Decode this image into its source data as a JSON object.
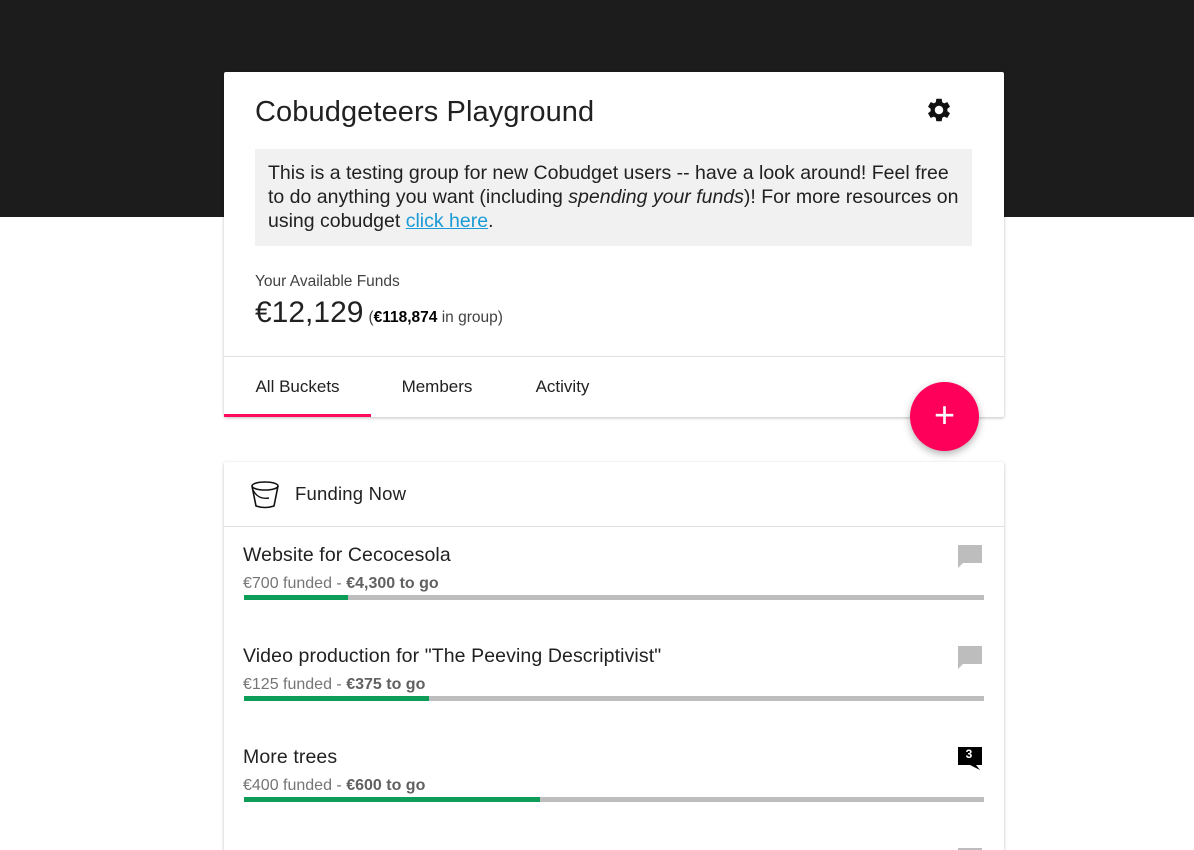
{
  "group": {
    "title": "Cobudgeteers Playground",
    "description": {
      "part1": "This is a testing group for new Cobudget users -- have a look around! Feel free to do anything you want (including ",
      "emphasis": "spending your funds",
      "part2": ")! For more resources on using cobudget ",
      "link_text": "click here",
      "part3": "."
    },
    "funds_label": "Your Available Funds",
    "funds_amount": "€12,129",
    "funds_group_open": "(",
    "funds_group_amount": "€118,874",
    "funds_group_close": " in group)"
  },
  "tabs": [
    {
      "label": "All Buckets",
      "active": true
    },
    {
      "label": "Members",
      "active": false
    },
    {
      "label": "Activity",
      "active": false
    }
  ],
  "fab": {
    "label": "+"
  },
  "section": {
    "heading": "Funding Now"
  },
  "buckets": [
    {
      "title": "Website for Cecocesola",
      "funded": "€700 funded",
      "separator": " - ",
      "to_go": "€4,300 to go",
      "progress": 0.14,
      "comment_count": ""
    },
    {
      "title": "Video production for \"The Peeving Descriptivist\"",
      "funded": "€125 funded",
      "separator": " - ",
      "to_go": "€375 to go",
      "progress": 0.25,
      "comment_count": ""
    },
    {
      "title": "More trees",
      "funded": "€400 funded",
      "separator": " - ",
      "to_go": "€600 to go",
      "progress": 0.4,
      "comment_count": "3"
    }
  ],
  "colors": {
    "accent": "#fe0059",
    "progress": "#0e9d58",
    "link": "#1a9ad6",
    "header_band": "#1c1c1c"
  },
  "icons": {
    "settings": "gear-icon",
    "section": "bucket-icon",
    "comment": "comment-icon"
  }
}
